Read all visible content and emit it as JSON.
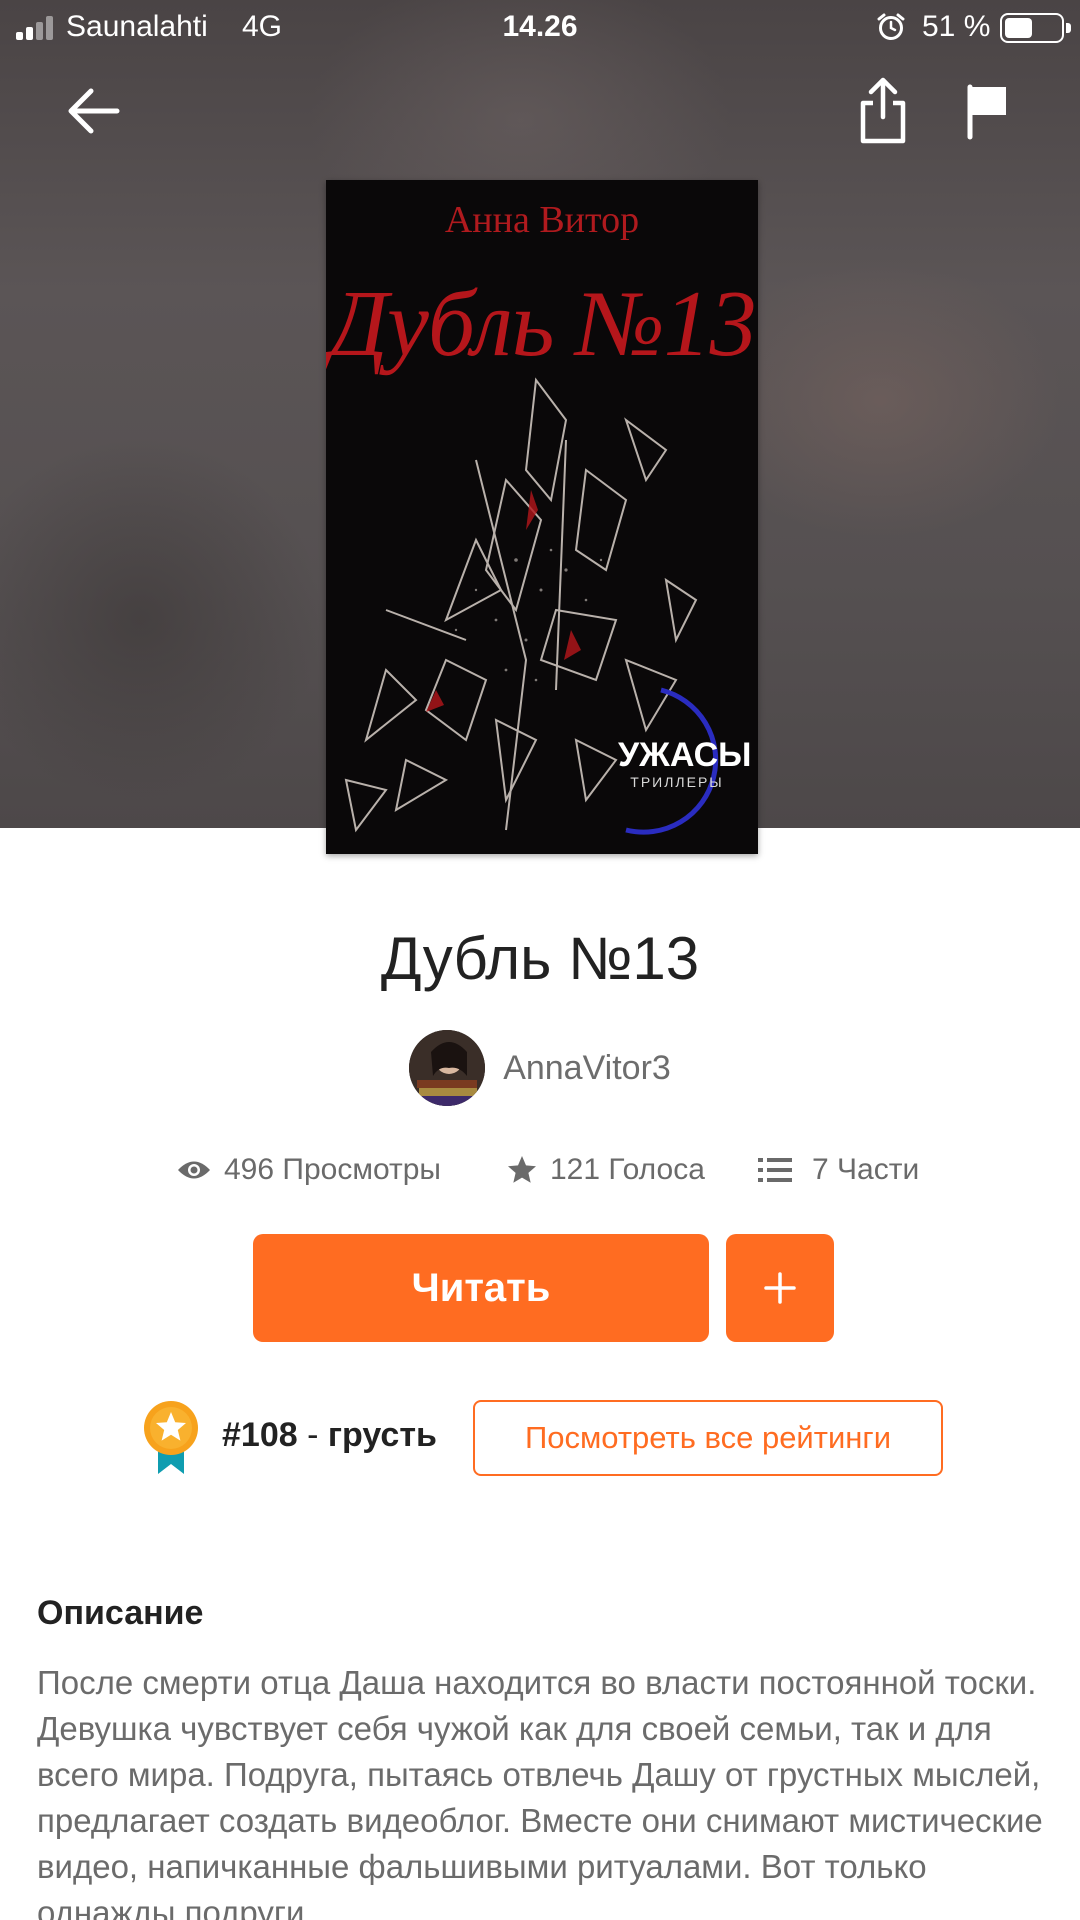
{
  "status_bar": {
    "carrier": "Saunalahti",
    "network": "4G",
    "time": "14.26",
    "battery_percent": "51 %",
    "battery_level": 0.51,
    "icons": [
      "signal-icon",
      "alarm-icon",
      "battery-icon"
    ]
  },
  "nav": {
    "icons": [
      "back-arrow-icon",
      "share-icon",
      "flag-icon"
    ]
  },
  "cover": {
    "author": "Анна Витор",
    "title": "Дубль №13",
    "genre": "УЖАСЫ",
    "subgenre": "ТРИЛЛЕРЫ"
  },
  "book": {
    "title": "Дубль №13",
    "author": "AnnaVitor3"
  },
  "stats": {
    "views_count": "496",
    "views_label": "Просмотры",
    "votes_count": "121",
    "votes_label": "Голоса",
    "parts_count": "7",
    "parts_label": "Части"
  },
  "actions": {
    "read_label": "Читать",
    "add_label": "+"
  },
  "ranking": {
    "rank": "#108",
    "separator": " - ",
    "category": "грусть",
    "view_all_label": "Посмотреть все рейтинги"
  },
  "description": {
    "heading": "Описание",
    "text": "После смерти отца Даша находится во власти постоянной тоски. Девушка чувствует себя чужой как для своей семьи, так и для всего мира. Подруга, пытаясь отвлечь Дашу от грустных мыслей, предлагает создать видеоблог. Вместе они снимают мистические видео, напичканные фальшивыми ритуалами. Вот только однажды подруги"
  },
  "colors": {
    "accent": "#ff6c21",
    "title_text": "#222222",
    "secondary_text": "#6b6b6b"
  }
}
